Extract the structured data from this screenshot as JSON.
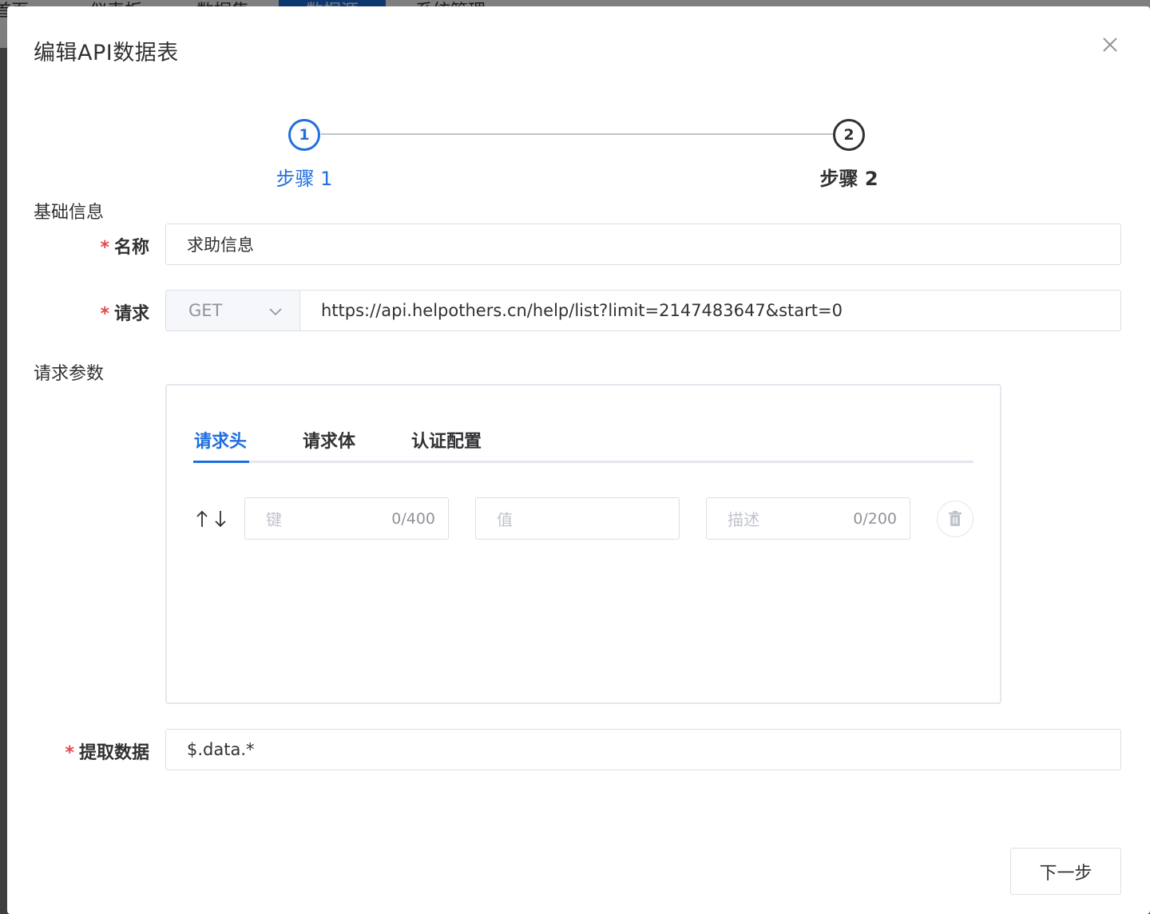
{
  "background_nav": {
    "items": [
      "首页",
      "仪表板",
      "数据集",
      "数据源",
      "系统管理"
    ],
    "active_index": 3
  },
  "dialog": {
    "title": "编辑API数据表"
  },
  "steps": [
    {
      "number": "1",
      "title": "步骤 1",
      "status": "active"
    },
    {
      "number": "2",
      "title": "步骤 2",
      "status": "wait"
    }
  ],
  "sections": {
    "basic_info": "基础信息",
    "request_params": "请求参数"
  },
  "form": {
    "name": {
      "label": "名称",
      "required": true,
      "value": "求助信息"
    },
    "request": {
      "label": "请求",
      "required": true,
      "method": "GET",
      "url": "https://api.helpothers.cn/help/list?limit=2147483647&start=0"
    },
    "extract": {
      "label": "提取数据",
      "required": true,
      "value": "$.data.*"
    }
  },
  "params": {
    "tabs": [
      {
        "label": "请求头",
        "active": true
      },
      {
        "label": "请求体",
        "active": false
      },
      {
        "label": "认证配置",
        "active": false
      }
    ],
    "row": {
      "key_placeholder": "键",
      "key_count": "0/400",
      "value_placeholder": "值",
      "desc_placeholder": "描述",
      "desc_count": "0/200"
    }
  },
  "footer": {
    "next_label": "下一步"
  },
  "colors": {
    "primary": "#1f6fde",
    "required": "#e5484d",
    "border": "#dcdfe6"
  }
}
